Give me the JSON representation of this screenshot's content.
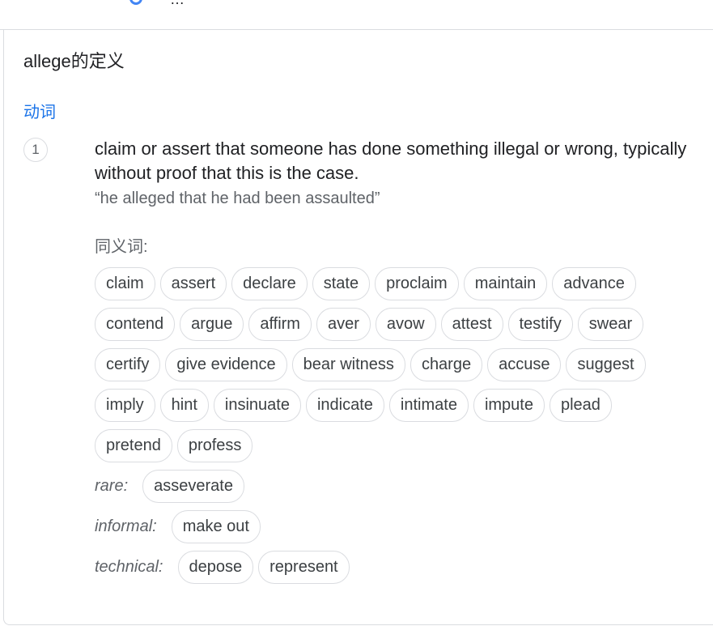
{
  "header": {
    "partial_text": "…",
    "icon": "google-g-icon"
  },
  "entry": {
    "title": "allege的定义",
    "part_of_speech": "动词",
    "sense_number": "1",
    "definition": "claim or assert that someone has done something illegal or wrong, typically without proof that this is the case.",
    "example": "“he alleged that he had been assaulted”",
    "synonyms_label": "同义词:",
    "synonym_rows": [
      [
        "claim",
        "assert",
        "declare",
        "state",
        "proclaim",
        "maintain",
        "advance"
      ],
      [
        "contend",
        "argue",
        "affirm",
        "aver",
        "avow",
        "attest",
        "testify",
        "swear"
      ],
      [
        "certify",
        "give evidence",
        "bear witness",
        "charge",
        "accuse",
        "suggest"
      ],
      [
        "imply",
        "hint",
        "insinuate",
        "indicate",
        "intimate",
        "impute",
        "plead"
      ],
      [
        "pretend",
        "profess"
      ]
    ],
    "register_groups": [
      {
        "label": "rare:",
        "words": [
          "asseverate"
        ]
      },
      {
        "label": "informal:",
        "words": [
          "make out"
        ]
      },
      {
        "label": "technical:",
        "words": [
          "depose",
          "represent"
        ]
      }
    ]
  },
  "colors": {
    "accent": "#1a73e8",
    "text": "#202124",
    "secondary_text": "#5f6368",
    "chip_border": "#dadce0"
  }
}
